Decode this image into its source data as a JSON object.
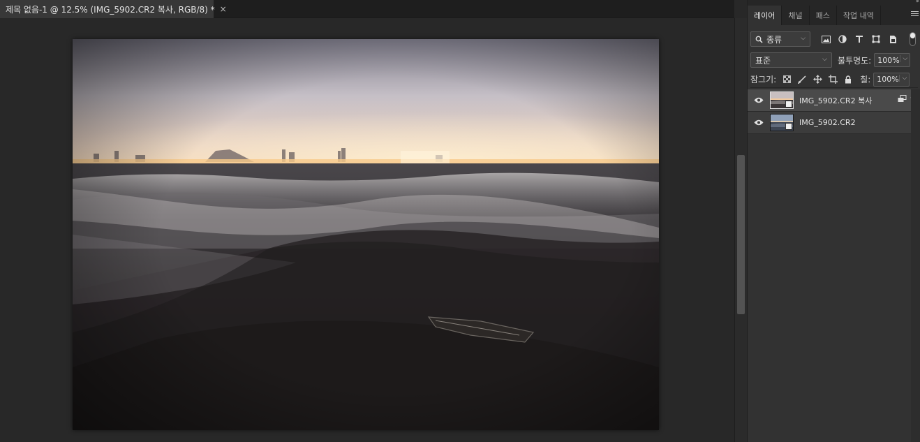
{
  "document": {
    "tab_title": "제목 없음-1 @ 12.5% (IMG_5902.CR2 복사, RGB/8) *",
    "close_glyph": "×"
  },
  "panels": {
    "tabs": [
      {
        "label": "레이어",
        "active": true
      },
      {
        "label": "채널",
        "active": false
      },
      {
        "label": "패스",
        "active": false
      },
      {
        "label": "작업 내역",
        "active": false
      }
    ],
    "filter": {
      "kind_label": "종류",
      "icons": [
        "image-filter-icon",
        "adjustment-filter-icon",
        "type-filter-icon",
        "shape-filter-icon",
        "smart-object-filter-icon"
      ]
    },
    "blend_mode": "표준",
    "opacity_label": "불투명도:",
    "opacity_value": "100%",
    "lock_label": "잠그기:",
    "lock_icons": [
      "lock-transparent-pixels-icon",
      "lock-image-pixels-icon",
      "lock-position-icon",
      "lock-artboard-icon",
      "lock-all-icon"
    ],
    "fill_label": "칠:",
    "fill_value": "100%",
    "layers": [
      {
        "name": "IMG_5902.CR2 복사",
        "visible": true,
        "selected": true
      },
      {
        "name": "IMG_5902.CR2",
        "visible": true,
        "selected": false
      }
    ]
  },
  "colors": {
    "app_bg": "#282828",
    "panel_bg": "#323232",
    "selected_layer_bg": "#4a4a4a"
  }
}
